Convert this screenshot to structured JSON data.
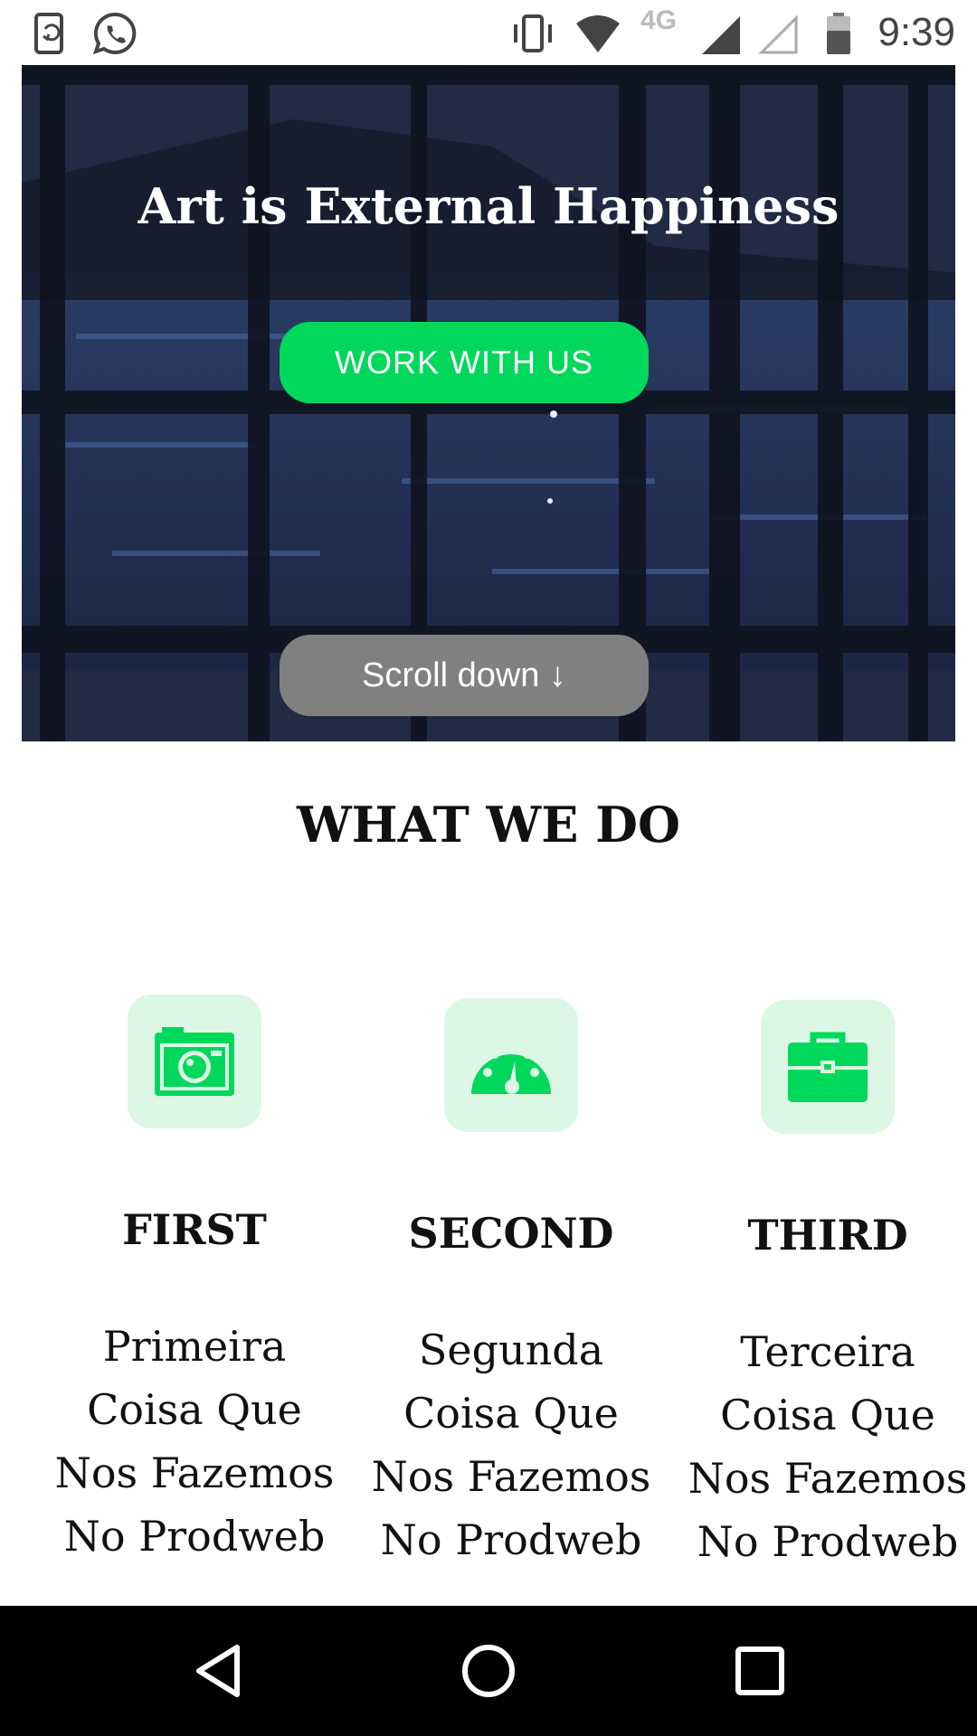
{
  "status_bar": {
    "time": "9:39",
    "network": "4G",
    "icons": [
      "phone-sync-icon",
      "whatsapp-icon",
      "vibrate-icon",
      "wifi-icon",
      "signal-icon",
      "signal-empty-icon",
      "battery-icon"
    ]
  },
  "hero": {
    "title": "Art is External Happiness",
    "cta_label": "WORK WITH US",
    "scroll_label": "Scroll down ↓",
    "colors": {
      "cta": "#00d85c",
      "scroll": "#808080"
    }
  },
  "section": {
    "title": "WHAT WE DO",
    "features": [
      {
        "icon": "camera-icon",
        "heading": "FIRST",
        "lines": [
          "Primeira",
          "Coisa Que",
          "Nos Fazemos",
          "No Prodweb"
        ]
      },
      {
        "icon": "speedometer-icon",
        "heading": "SECOND",
        "lines": [
          "Segunda",
          "Coisa Que",
          "Nos Fazemos",
          "No Prodweb"
        ]
      },
      {
        "icon": "briefcase-icon",
        "heading": "THIRD",
        "lines": [
          "Terceira",
          "Coisa Que",
          "Nos Fazemos",
          "No Prodweb"
        ]
      }
    ],
    "icon_color": "#00d85c",
    "icon_bg": "#ddf7e6"
  },
  "nav_bar": {
    "buttons": [
      "back-icon",
      "home-icon",
      "recents-icon"
    ]
  }
}
